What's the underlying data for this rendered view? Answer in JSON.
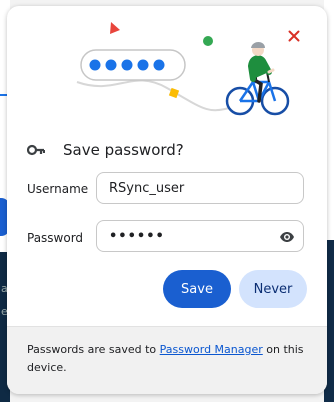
{
  "background": {
    "left_letters": [
      "a",
      "e"
    ]
  },
  "dialog": {
    "title": "Save password?",
    "username": {
      "label": "Username",
      "value": "RSync_user"
    },
    "password": {
      "label": "Password",
      "masked_value": "••••••"
    },
    "buttons": {
      "save": "Save",
      "never": "Never"
    },
    "footer": {
      "text_before": "Passwords are saved to ",
      "link": "Password Manager",
      "text_after": " on this device."
    },
    "icons": [
      "close-icon",
      "key-icon",
      "eye-icon"
    ],
    "colors": {
      "accent": "#1a5fd0",
      "secondary_button": "#d3e3fd",
      "close": "#d93025",
      "cyclist_shirt": "#1e8e3e"
    }
  }
}
